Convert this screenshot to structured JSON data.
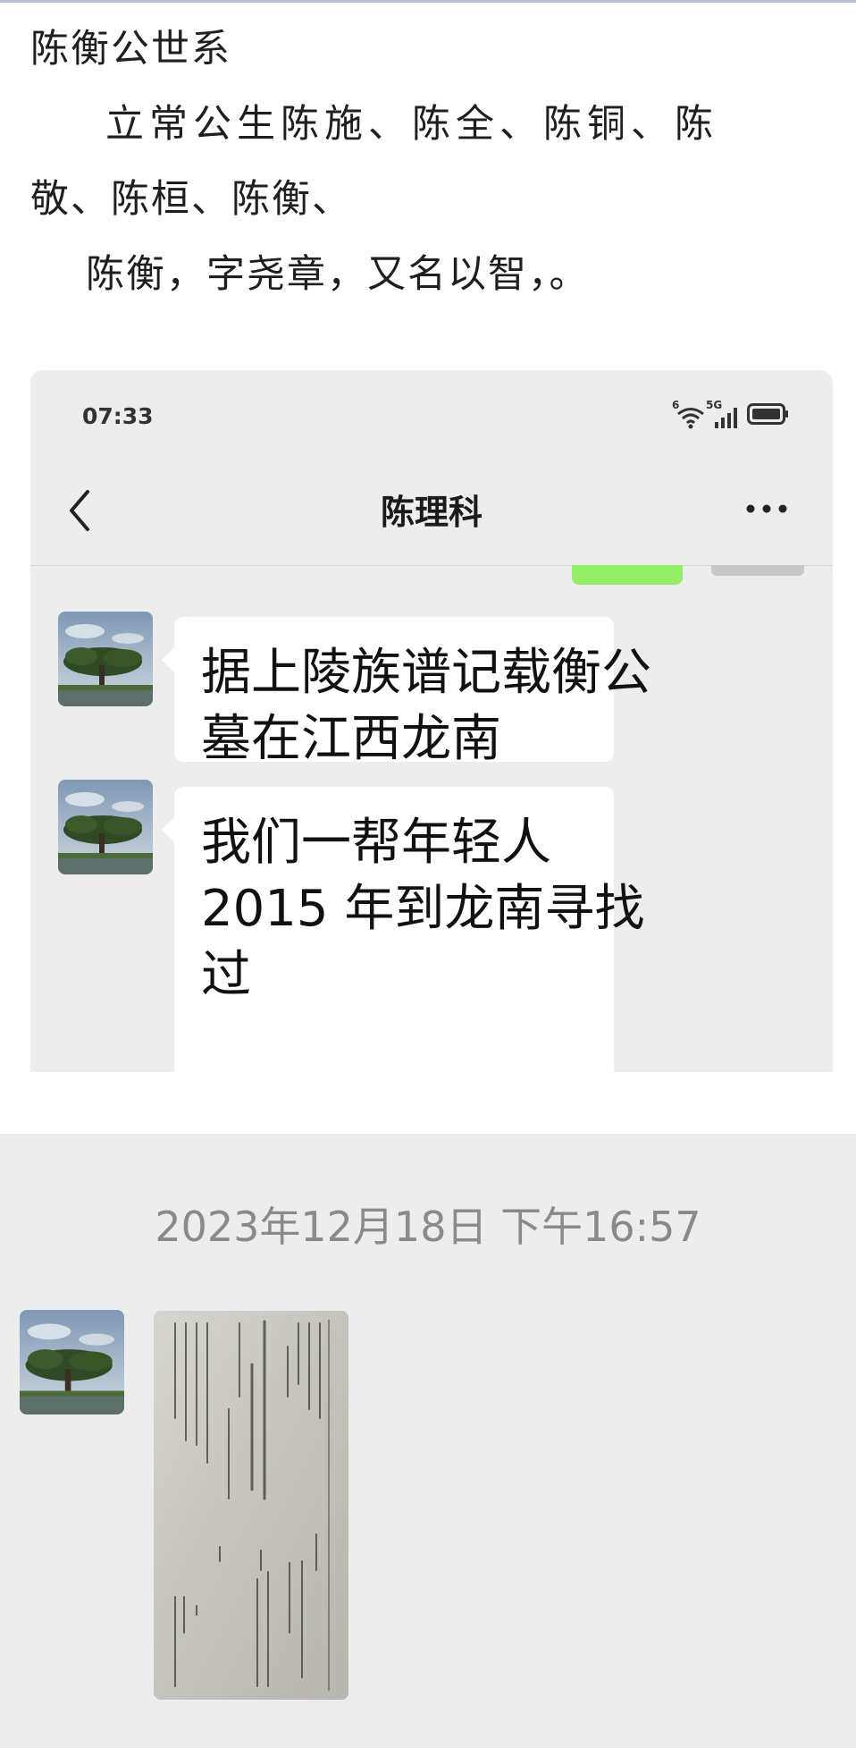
{
  "article": {
    "title": "陈衡公世系",
    "paragraph_line1": "立常公生陈施、陈全、陈铜、陈",
    "paragraph_line2": "敬、陈桓、陈衡、",
    "paragraph_line3": "陈衡，字尧章，又名以智，。"
  },
  "screenshot": {
    "status_time": "07:33",
    "network_label": "5G",
    "wifi_label": "6",
    "chat_title": "陈理科",
    "messages": [
      {
        "line1": "据上陵族谱记载衡公",
        "line2": "墓在江西龙南"
      },
      {
        "line1": "我们一帮年轻人",
        "line2": "2015 年到龙南寻找",
        "line3": "过"
      }
    ]
  },
  "lower_chat": {
    "timestamp": "2023年12月18日 下午16:57"
  },
  "colors": {
    "chat_background": "#ededed",
    "bubble": "#ffffff",
    "sent_bubble": "#95ec69",
    "timestamp": "#8a8a8a"
  },
  "icons": [
    "back-arrow-icon",
    "more-dots-icon",
    "wifi-icon",
    "signal-icon",
    "battery-icon"
  ]
}
